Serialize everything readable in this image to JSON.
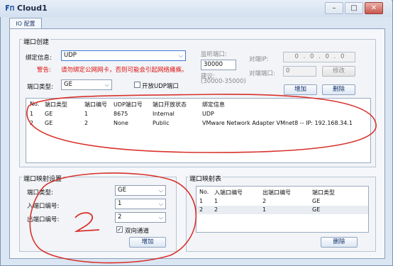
{
  "window": {
    "title": "Cloud1",
    "btn_minimize": "–",
    "btn_maximize": "□",
    "btn_close": "✕"
  },
  "tab": {
    "label": "IO 配置"
  },
  "port_create": {
    "title": "端口创建",
    "bind_label": "绑定信息:",
    "bind_value": "UDP",
    "warning_label": "警告:",
    "warning_text": "请勿绑定公网网卡，否则可能会引起网络瘫痪。",
    "listen_port_label": "监听端口:",
    "listen_port_value": "30000",
    "suggest_label": "建议:",
    "suggest_value": "(30000-35000)",
    "peer_ip_label": "对端IP:",
    "peer_ip_value": "0 . 0 . 0 . 0",
    "peer_port_label": "对端端口:",
    "peer_port_value": "0",
    "modify_button": "修改",
    "port_type_label": "端口类型:",
    "port_type_value": "GE",
    "open_udp_label": "开放UDP端口",
    "add_button": "增加",
    "delete_button": "删除",
    "table": {
      "headers": [
        "No.",
        "端口类型",
        "端口编号",
        "UDP端口号",
        "端口开放状态",
        "绑定信息"
      ],
      "rows": [
        [
          "1",
          "GE",
          "1",
          "8675",
          "Internal",
          "UDP"
        ],
        [
          "2",
          "GE",
          "2",
          "None",
          "Public",
          "VMware Network Adapter VMnet8 -- IP: 192.168.34.1"
        ]
      ]
    }
  },
  "port_map_setting": {
    "title": "端口映射设置",
    "port_type_label": "端口类型:",
    "port_type_value": "GE",
    "in_port_label": "入端口编号:",
    "in_port_value": "1",
    "out_port_label": "出端口编号:",
    "out_port_value": "2",
    "bidir_label": "双向通道",
    "add_button": "增加"
  },
  "port_map_table": {
    "title": "端口映射表",
    "headers": [
      "No.",
      "入端口编号",
      "出端口编号",
      "端口类型"
    ],
    "rows": [
      [
        "1",
        "1",
        "2",
        "GE"
      ],
      [
        "2",
        "2",
        "1",
        "GE"
      ]
    ],
    "delete_button": "删除"
  },
  "annotation": {
    "number": "2",
    "color": "#d8322c"
  },
  "colors": {
    "accent": "#1f3b6a",
    "warning": "#dd1111",
    "window_bg": "#dbe6f3"
  }
}
